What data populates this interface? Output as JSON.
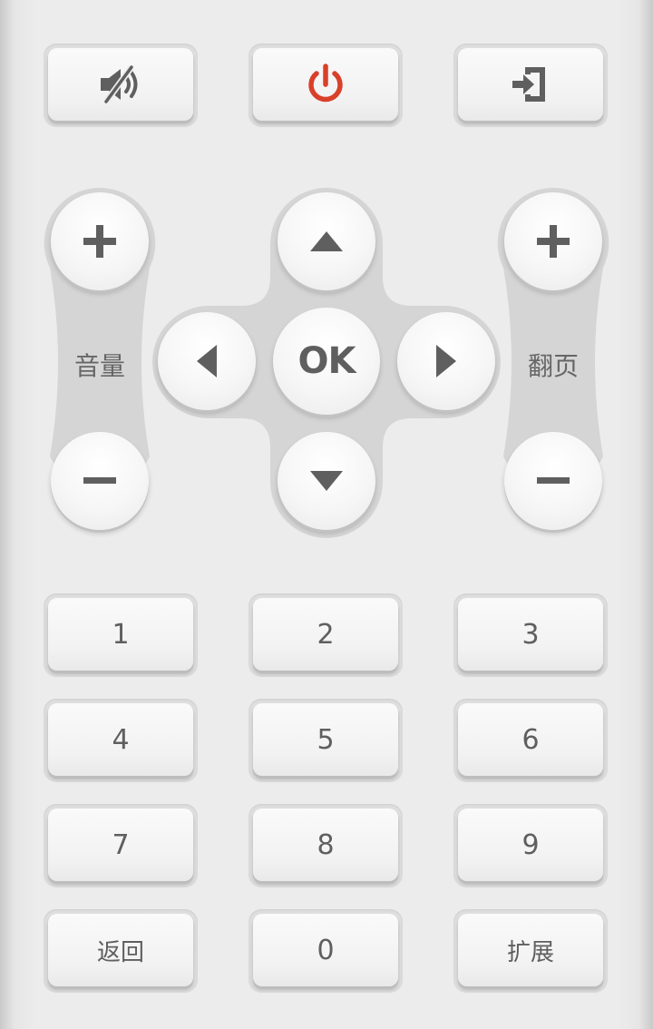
{
  "top_row": {
    "mute_icon": "mute-icon",
    "power_icon": "power-icon",
    "input_icon": "input-source-icon"
  },
  "volume": {
    "label": "音量",
    "plus_icon": "plus-icon",
    "minus_icon": "minus-icon"
  },
  "page": {
    "label": "翻页",
    "plus_icon": "plus-icon",
    "minus_icon": "minus-icon"
  },
  "dpad": {
    "ok_label": "OK"
  },
  "numpad": {
    "k1": "1",
    "k2": "2",
    "k3": "3",
    "k4": "4",
    "k5": "5",
    "k6": "6",
    "k7": "7",
    "k8": "8",
    "k9": "9",
    "back": "返回",
    "k0": "0",
    "extend": "扩展"
  },
  "colors": {
    "power": "#d9402a",
    "icon": "#5f5f5f",
    "background": "#ececec"
  }
}
